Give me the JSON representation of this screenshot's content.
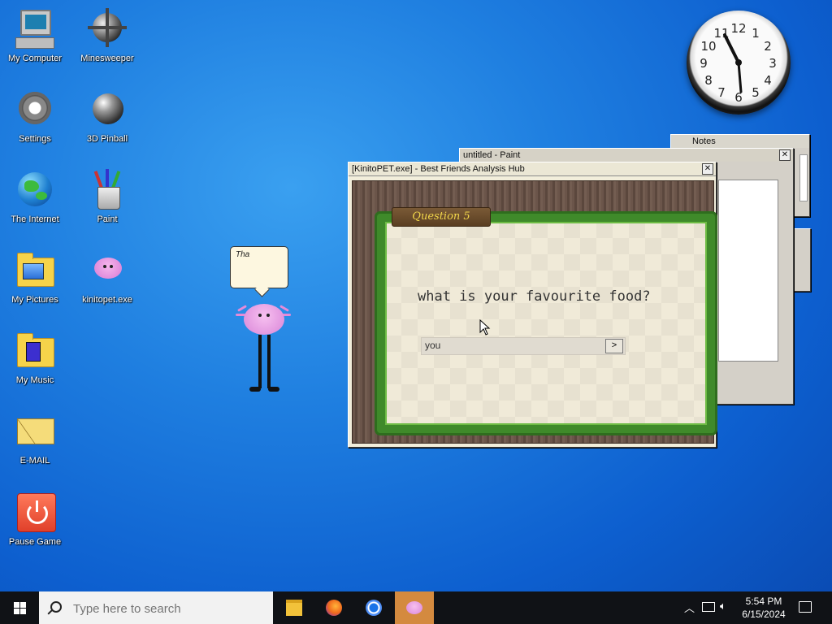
{
  "desktop": {
    "icons": [
      {
        "label": "My Computer"
      },
      {
        "label": "Minesweeper"
      },
      {
        "label": "Settings"
      },
      {
        "label": "3D Pinball"
      },
      {
        "label": "The Internet"
      },
      {
        "label": "Paint"
      },
      {
        "label": "My Pictures"
      },
      {
        "label": "kinitopet.exe"
      },
      {
        "label": "My Music"
      },
      {
        "label": "E-MAIL"
      },
      {
        "label": "Pause Game"
      }
    ]
  },
  "clock_widget": {
    "numbers": [
      "12",
      "1",
      "2",
      "3",
      "4",
      "5",
      "6",
      "7",
      "8",
      "9",
      "10",
      "11"
    ]
  },
  "windows": {
    "notes": {
      "title": "Notes"
    },
    "paint": {
      "title": "untitled - Paint"
    },
    "kinito": {
      "title": "[KinitoPET.exe] - Best Friends Analysis Hub",
      "question_tag": "Question 5",
      "question": "what is your favourite food?",
      "answer_value": "you",
      "submit_label": ">"
    }
  },
  "buddy": {
    "speech": "Tha"
  },
  "taskbar": {
    "search_placeholder": "Type here to search",
    "time": "5:54 PM",
    "date": "6/15/2024"
  },
  "colors": {
    "desktop": "#1f7fe0",
    "taskbar": "#101216",
    "active_app": "#d48a3f",
    "vine": "#3f8a2a",
    "question_tag_text": "#f1d64a"
  }
}
